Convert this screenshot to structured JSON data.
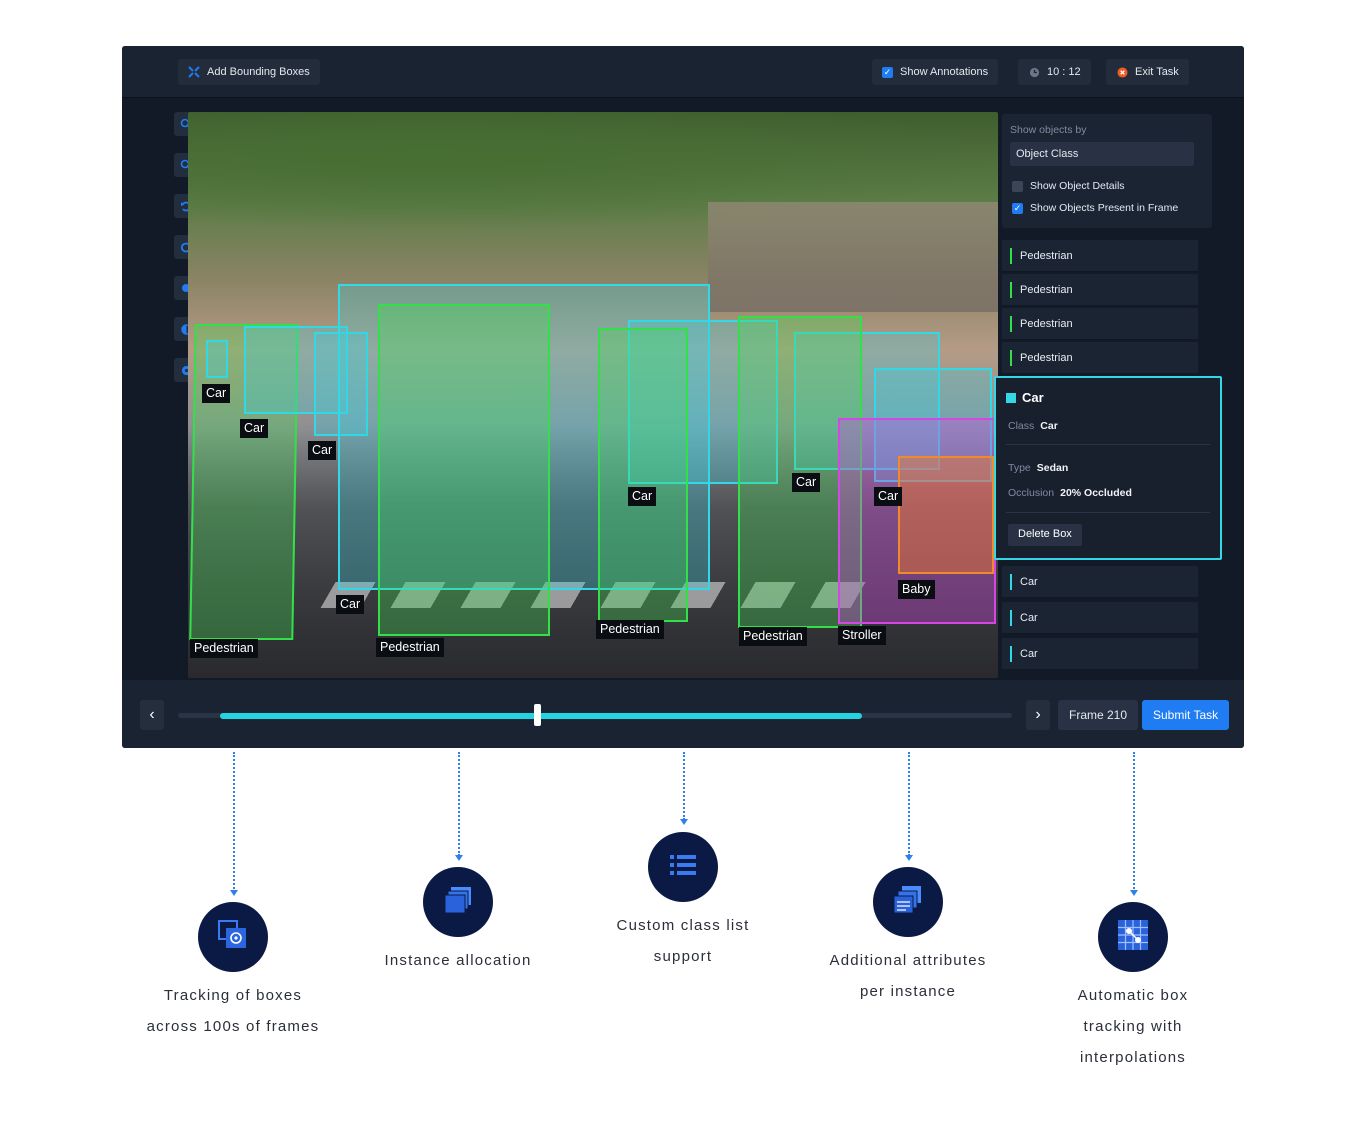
{
  "toolbar": {
    "add_boxes": "Add Bounding Boxes",
    "show_annotations": "Show Annotations",
    "timer": "10 : 12",
    "exit": "Exit Task"
  },
  "tools": [
    {
      "icon": "zoom-in-icon"
    },
    {
      "icon": "zoom-out-icon"
    },
    {
      "icon": "undo-icon"
    },
    {
      "icon": "redo-icon"
    },
    {
      "icon": "circle-tool-icon"
    },
    {
      "icon": "contrast-icon"
    },
    {
      "icon": "settings-icon"
    }
  ],
  "annotations": [
    {
      "label": "Pedestrian",
      "cls": "g"
    },
    {
      "label": "Pedestrian",
      "cls": "g"
    },
    {
      "label": "Pedestrian",
      "cls": "g"
    },
    {
      "label": "Pedestrian",
      "cls": "g"
    },
    {
      "label": "Car",
      "cls": "c"
    },
    {
      "label": "Car",
      "cls": "c"
    },
    {
      "label": "Car",
      "cls": "c"
    },
    {
      "label": "Car",
      "cls": "c"
    },
    {
      "label": "Car",
      "cls": "c"
    },
    {
      "label": "Car",
      "cls": "c"
    },
    {
      "label": "Stroller",
      "cls": "m"
    },
    {
      "label": "Baby",
      "cls": "o"
    }
  ],
  "panel": {
    "show_by_label": "Show objects by",
    "show_by_value": "Object Class",
    "opt_details": "Show Object Details",
    "opt_details_checked": false,
    "opt_present": "Show Objects Present in Frame",
    "opt_present_checked": true
  },
  "object_list": {
    "top": [
      "Pedestrian",
      "Pedestrian",
      "Pedestrian",
      "Pedestrian"
    ],
    "bottom": [
      "Car",
      "Car",
      "Car"
    ]
  },
  "detail": {
    "title": "Car",
    "class_label": "Class",
    "class_value": "Car",
    "type_label": "Type",
    "type_value": "Sedan",
    "occlusion_label": "Occlusion",
    "occlusion_value": "20% Occluded",
    "delete": "Delete Box"
  },
  "timeline": {
    "progress": 0.82,
    "playhead": 0.43,
    "frame": "Frame 210",
    "submit": "Submit Task"
  },
  "colors": {
    "accent": "#1f7cf2",
    "pedestrian": "#33e04a",
    "car": "#33d8e6",
    "stroller": "#d447e4",
    "baby": "#f08a2a",
    "feature_circle": "#0b1a44"
  },
  "features": [
    {
      "icon": "frames-target-icon",
      "text": [
        "Tracking of boxes",
        "across 100s of frames"
      ]
    },
    {
      "icon": "stacked-layers-icon",
      "text": [
        "Instance allocation"
      ]
    },
    {
      "icon": "list-icon",
      "text": [
        "Custom class list",
        "support"
      ]
    },
    {
      "icon": "layered-docs-icon",
      "text": [
        "Additional attributes",
        "per instance"
      ]
    },
    {
      "icon": "grid-tracking-icon",
      "text": [
        "Automatic box",
        "tracking with",
        "interpolations"
      ]
    }
  ]
}
